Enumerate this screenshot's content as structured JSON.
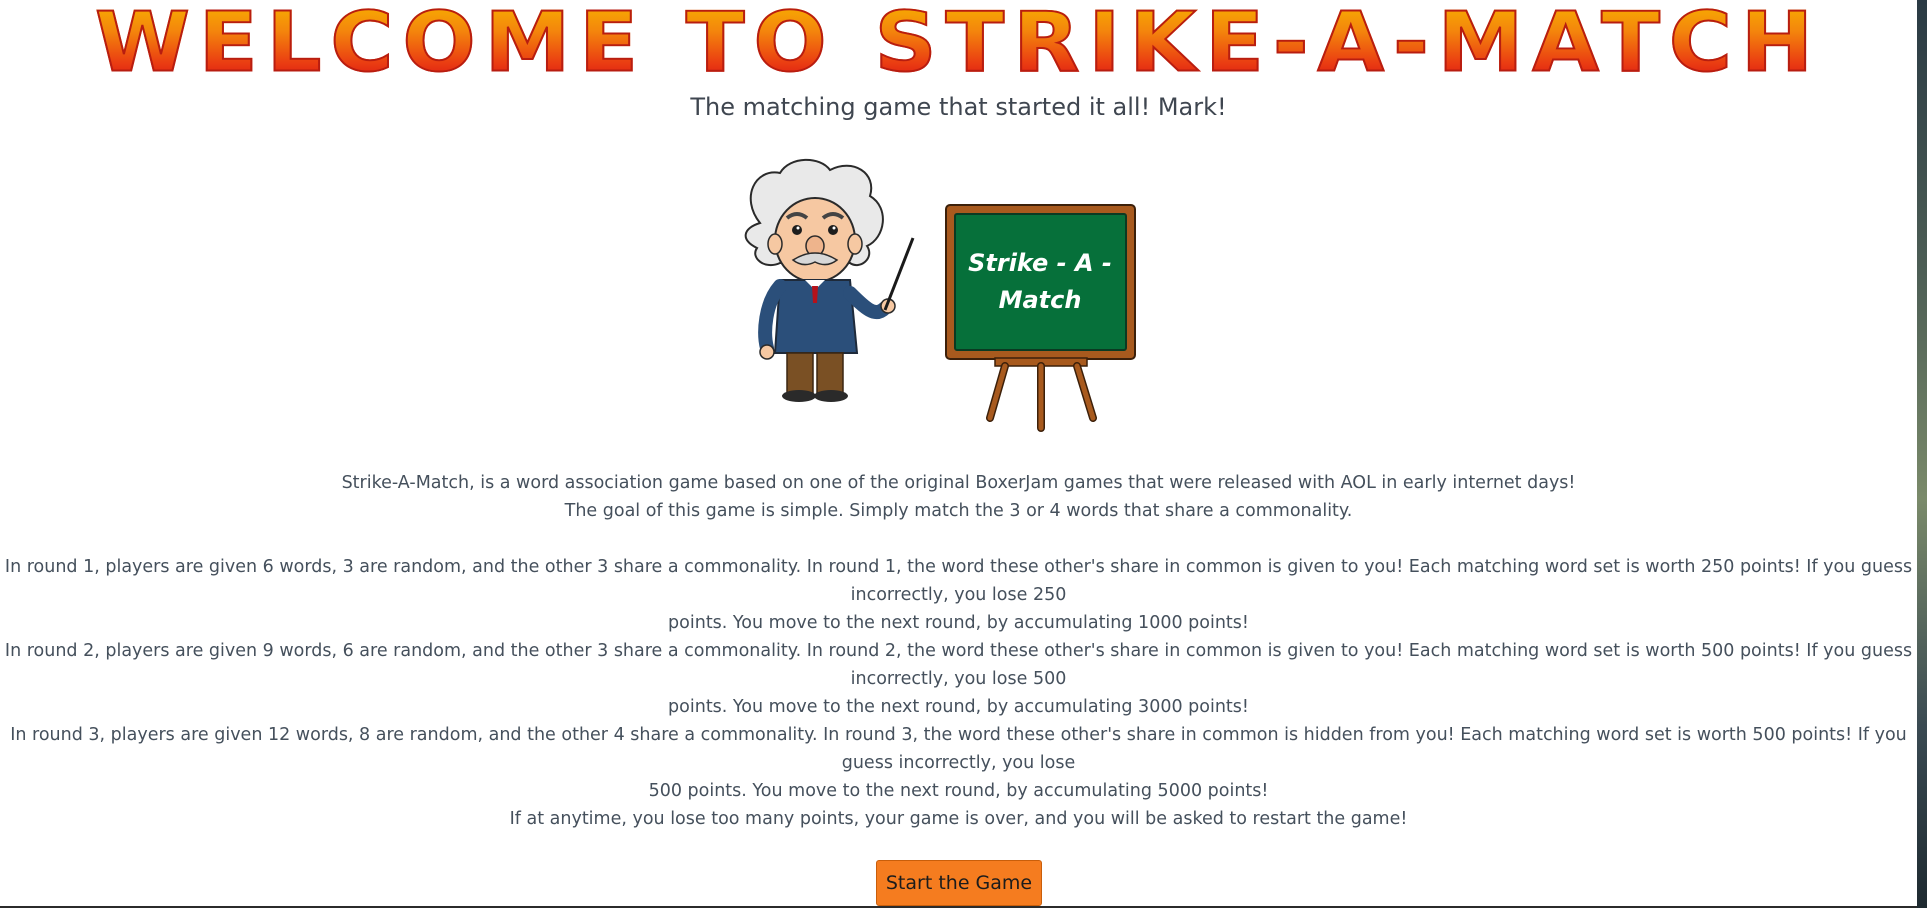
{
  "header": {
    "title": "WELCOME TO STRIKE-A-MATCH",
    "subtitle": "The matching game that started it all! Mark!"
  },
  "hero": {
    "board_line1": "Strike - A -",
    "board_line2": "Match"
  },
  "intro": {
    "line1": "Strike-A-Match, is a word association game based on one of the original BoxerJam games that were released with AOL in early internet days!",
    "line2": "The goal of this game is simple. Simply match the 3 or 4 words that share a commonality."
  },
  "rounds": [
    {
      "line1": "In round 1, players are given 6 words, 3 are random, and the other 3 share a commonality. In round 1, the word these other's share in common is given to you! Each matching word set is worth 250 points! If you guess incorrectly, you lose 250",
      "line2": "points. You move to the next round, by accumulating 1000 points!"
    },
    {
      "line1": "In round 2, players are given 9 words, 6 are random, and the other 3 share a commonality. In round 2, the word these other's share in common is given to you! Each matching word set is worth 500 points! If you guess incorrectly, you lose 500",
      "line2": "points. You move to the next round, by accumulating 3000 points!"
    },
    {
      "line1": "In round 3, players are given 12 words, 8 are random, and the other 4 share a commonality. In round 3, the word these other's share in common is hidden from you! Each matching word set is worth 500 points! If you guess incorrectly, you lose",
      "line2": "500 points. You move to the next round, by accumulating 5000 points!"
    }
  ],
  "warning": "If at anytime, you lose too many points, your game is over, and you will be asked to restart the game!",
  "start_button": "Start the Game",
  "colors": {
    "title_top": "#f7b000",
    "title_bottom": "#d91414",
    "button": "#f57c1f",
    "board_green": "#06703a",
    "frame_brown": "#a85a1e"
  }
}
